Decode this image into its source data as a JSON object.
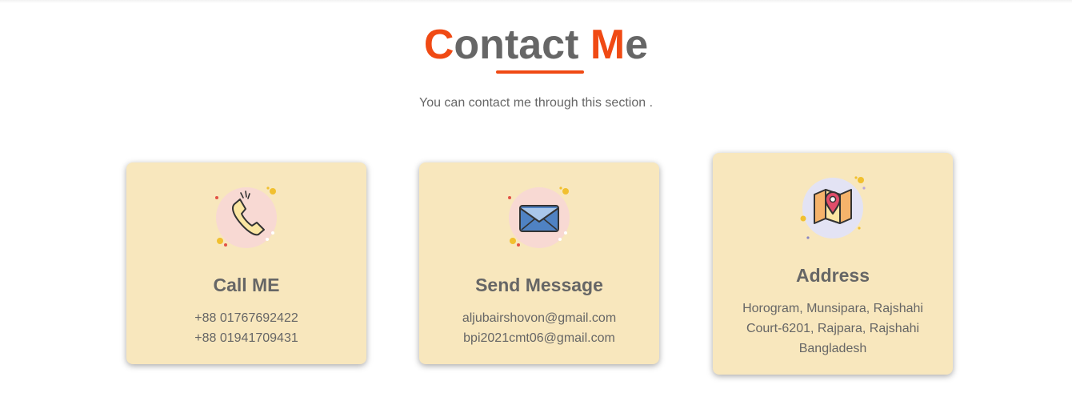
{
  "header": {
    "title_first_letter": "C",
    "title_rest_1": "ontact ",
    "title_second_letter": "M",
    "title_rest_2": "e",
    "subtitle": "You can contact me through this section ."
  },
  "colors": {
    "accent": "#f04a14",
    "text": "#666666",
    "card_bg": "#f8e7bd"
  },
  "cards": [
    {
      "icon": "phone-icon",
      "title": "Call ME",
      "lines": [
        "+88 01767692422",
        "+88 01941709431"
      ]
    },
    {
      "icon": "envelope-icon",
      "title": "Send Message",
      "lines": [
        "aljubairshovon@gmail.com",
        "bpi2021cmt06@gmail.com"
      ]
    },
    {
      "icon": "map-pin-icon",
      "title": "Address",
      "lines": [
        "Horogram, Munsipara, Rajshahi",
        "Court-6201, Rajpara, Rajshahi",
        "Bangladesh"
      ]
    }
  ]
}
